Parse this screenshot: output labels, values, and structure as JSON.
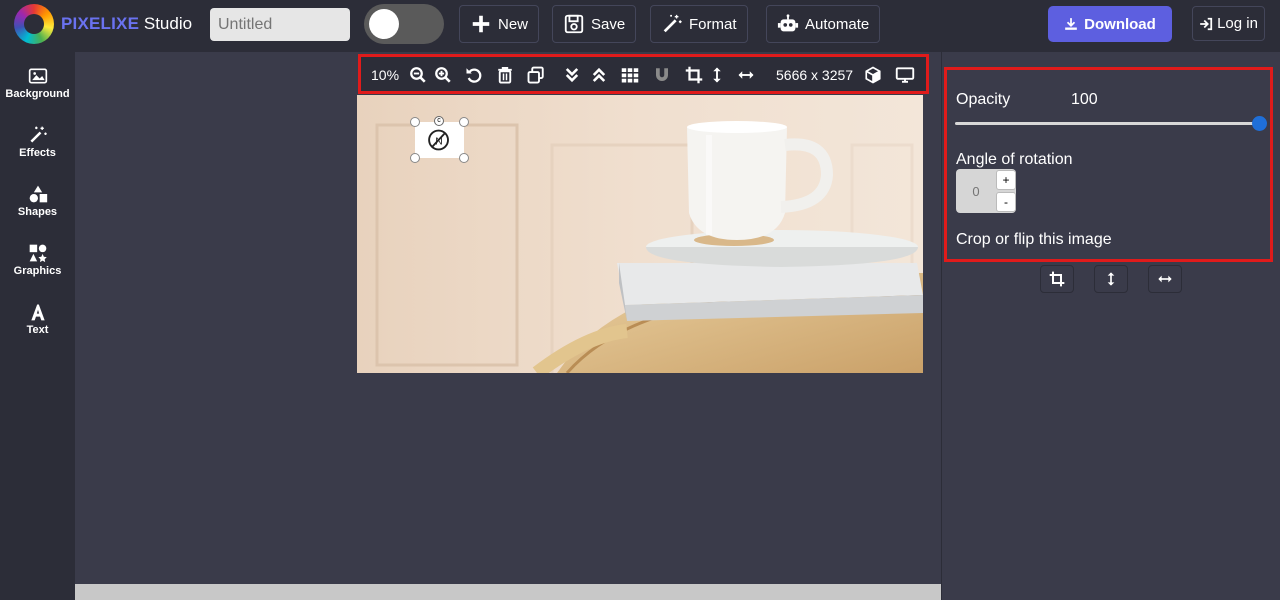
{
  "brand": {
    "name_part1": "PIXELIXE",
    "name_part2": "Studio"
  },
  "header": {
    "title_placeholder": "Untitled",
    "new_label": "New",
    "save_label": "Save",
    "format_label": "Format",
    "automate_label": "Automate",
    "download_label": "Download",
    "login_label": "Log in"
  },
  "sidebar": {
    "items": [
      {
        "label": "Background",
        "icon": "image-icon"
      },
      {
        "label": "Effects",
        "icon": "magic-wand-icon"
      },
      {
        "label": "Shapes",
        "icon": "shapes-icon"
      },
      {
        "label": "Graphics",
        "icon": "graphics-icon"
      },
      {
        "label": "Text",
        "icon": "text-icon"
      }
    ]
  },
  "canvas_toolbar": {
    "zoom": "10%",
    "dimensions": "5666 x 3257"
  },
  "properties": {
    "opacity_label": "Opacity",
    "opacity_value": "100",
    "opacity_level": 1.0,
    "rotation_label": "Angle of rotation",
    "rotation_value": "0",
    "increment_label": "+",
    "decrement_label": "-",
    "crop_flip_label": "Crop or flip this image"
  },
  "colors": {
    "accent": "#5d5fe0",
    "highlight_border": "#e01b1b",
    "slider_knob": "#1f6fd8"
  }
}
